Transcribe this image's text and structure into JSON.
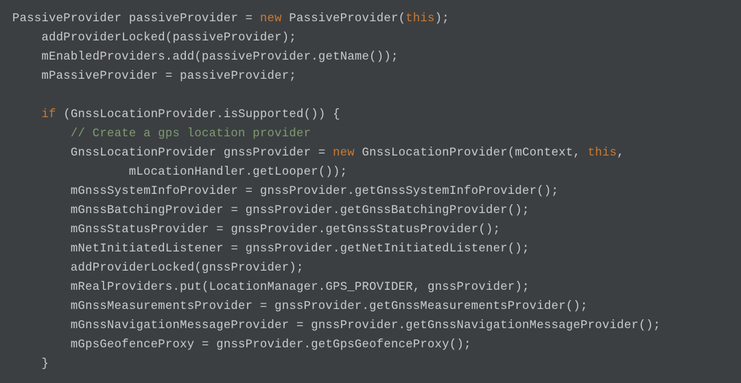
{
  "code": {
    "t_PassiveProvider": "PassiveProvider",
    "v_passiveProvider": "passiveProvider",
    "kw_new": "new",
    "kw_this": "this",
    "kw_if": "if",
    "fn_addProviderLocked": "addProviderLocked",
    "v_mEnabledProviders": "mEnabledProviders",
    "m_add": "add",
    "m_getName": "getName",
    "v_mPassiveProvider": "mPassiveProvider",
    "t_GnssLocationProvider": "GnssLocationProvider",
    "m_isSupported": "isSupported",
    "comment": "// Create a gps location provider",
    "v_gnssProvider": "gnssProvider",
    "v_mContext": "mContext",
    "v_mLocationHandler": "mLocationHandler",
    "m_getLooper": "getLooper",
    "v_mGnssSystemInfoProvider": "mGnssSystemInfoProvider",
    "m_getGnssSystemInfoProvider": "getGnssSystemInfoProvider",
    "v_mGnssBatchingProvider": "mGnssBatchingProvider",
    "m_getGnssBatchingProvider": "getGnssBatchingProvider",
    "v_mGnssStatusProvider": "mGnssStatusProvider",
    "m_getGnssStatusProvider": "getGnssStatusProvider",
    "v_mNetInitiatedListener": "mNetInitiatedListener",
    "m_getNetInitiatedListener": "getNetInitiatedListener",
    "v_mRealProviders": "mRealProviders",
    "m_put": "put",
    "t_LocationManager": "LocationManager",
    "c_GPS_PROVIDER": "GPS_PROVIDER",
    "v_mGnssMeasurementsProvider": "mGnssMeasurementsProvider",
    "m_getGnssMeasurementsProvider": "getGnssMeasurementsProvider",
    "v_mGnssNavigationMessageProvider": "mGnssNavigationMessageProvider",
    "m_getGnssNavigationMessageProvider": "getGnssNavigationMessageProvider",
    "v_mGpsGeofenceProxy": "mGpsGeofenceProxy",
    "m_getGpsGeofenceProxy": "getGpsGeofenceProxy"
  }
}
